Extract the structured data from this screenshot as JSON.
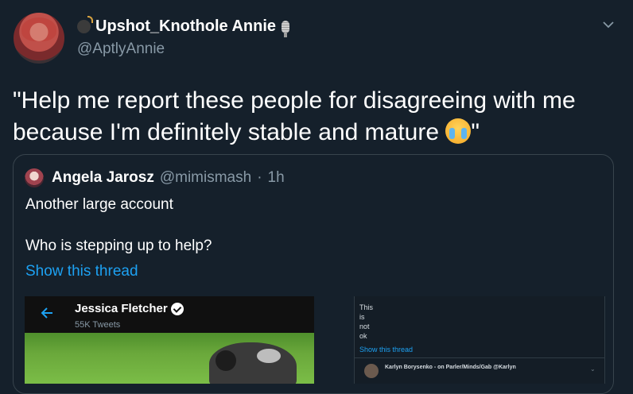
{
  "author": {
    "display_name": "Upshot_Knothole Annie",
    "handle": "@AptlyAnnie",
    "name_emojis": [
      "bomb-icon",
      "microphone-icon"
    ]
  },
  "tweet": {
    "text_before_emoji": "\"Help me report these people for disagreeing with me because I'm definitely stable and mature ",
    "text_after_emoji": "\"",
    "emoji": "loudly-crying-face"
  },
  "quoted": {
    "display_name": "Angela Jarosz",
    "handle": "@mimismash",
    "separator": "·",
    "time": "1h",
    "line1": "Another large account",
    "line2": "Who is stepping up to help?",
    "thread_link": "Show this thread",
    "media_left": {
      "title": "Jessica Fletcher",
      "subtitle": "55K Tweets"
    },
    "media_right": {
      "lines": [
        "This",
        "is",
        "not",
        "ok"
      ],
      "thread_link": "Show this thread",
      "author_line": "Karlyn Borysenko - on Parler/Minds/Gab @Karlyn"
    }
  },
  "colors": {
    "background": "#15202b",
    "secondary_text": "#8899a6",
    "link": "#1da1f2",
    "border": "#38444d"
  }
}
